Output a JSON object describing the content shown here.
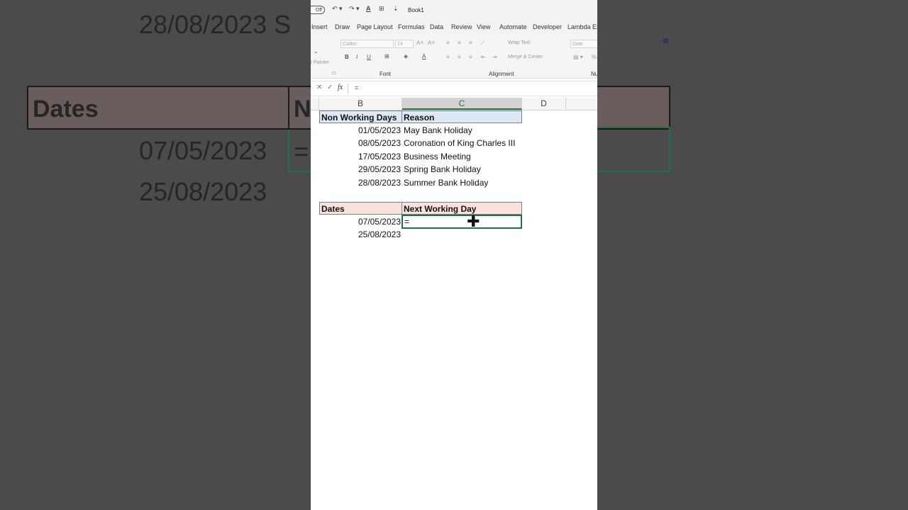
{
  "background_zoom": {
    "top_text": "28/08/2023 S",
    "header_dates": "Dates",
    "header_next": "N",
    "row1_date": "07/05/2023",
    "row1_formula": "=",
    "row2_date": "25/08/2023"
  },
  "titlebar": {
    "autosave_toggle": "Off",
    "book_name": "Book1"
  },
  "menu": [
    "Insert",
    "Draw",
    "Page Layout",
    "Formulas",
    "Data",
    "Review",
    "View",
    "Automate",
    "Developer",
    "Lambda Exp"
  ],
  "ribbon": {
    "format_painter": "t Painter",
    "font_name": "Calibri",
    "font_size": "14",
    "bold": "B",
    "italic": "I",
    "underline": "U",
    "wrap_text": "Wrap Text",
    "merge_center": "Merge & Center",
    "number_format": "Date",
    "group_font": "Font",
    "group_alignment": "Alignment",
    "group_number": "Nu"
  },
  "formula_bar": {
    "cancel": "✕",
    "enter": "✓",
    "fx": "fx",
    "content": "="
  },
  "columns": [
    "B",
    "C",
    "D"
  ],
  "holidays_table": {
    "headers": [
      "Non Working Days",
      "Reason"
    ],
    "rows": [
      {
        "date": "01/05/2023",
        "reason": "May Bank Holiday"
      },
      {
        "date": "08/05/2023",
        "reason": "Coronation of King Charles III"
      },
      {
        "date": "17/05/2023",
        "reason": "Business Meeting"
      },
      {
        "date": "29/05/2023",
        "reason": "Spring Bank Holiday"
      },
      {
        "date": "28/08/2023",
        "reason": "Summer Bank Holiday"
      }
    ]
  },
  "dates_table": {
    "headers": [
      "Dates",
      "Next Working Day"
    ],
    "rows": [
      {
        "date": "07/05/2023",
        "next": "="
      },
      {
        "date": "25/08/2023",
        "next": ""
      }
    ]
  },
  "colors": {
    "accent_green": "#1e7145",
    "header_blue": "#dde8f6",
    "header_pink": "#fbe2dc",
    "side_gray": "#4b4b4b"
  }
}
